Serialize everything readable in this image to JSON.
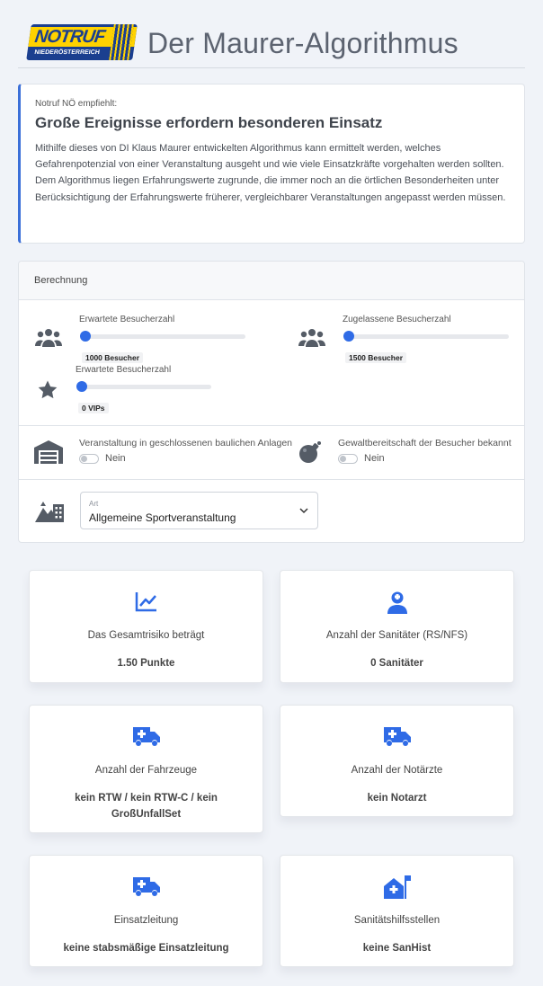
{
  "header": {
    "logo_text_top": "NOTRUF",
    "logo_text_bottom": "NIEDERÖSTERREICH",
    "title": "Der Maurer-Algorithmus"
  },
  "intro": {
    "pretitle": "Notruf NÖ empfiehlt:",
    "title": "Große Ereignisse erfordern besonderen Einsatz",
    "body": "Mithilfe dieses von DI Klaus Maurer entwickelten Algorithmus kann ermittelt werden, welches Gefahrenpotenzial von einer Veranstaltung ausgeht und wie viele Einsatzkräfte vorgehalten werden sollten. Dem Algorithmus liegen Erfahrungswerte zugrunde, die immer noch an die örtlichen Besonderheiten unter Berücksichtigung der Erfahrungswerte früherer, vergleichbarer Veranstaltungen angepasst werden müssen."
  },
  "calc": {
    "header": "Berechnung",
    "sliders": [
      {
        "label": "Erwartete Besucherzahl",
        "value": "1000 Besucher",
        "icon": "people-group-icon",
        "fill": 0.0
      },
      {
        "label": "Zugelassene Besucherzahl",
        "value": "1500 Besucher",
        "icon": "people-group-icon",
        "fill": 0.0
      },
      {
        "label": "Erwartete Besucherzahl",
        "value": "0 VIPs",
        "icon": "star-icon",
        "fill": 0.0
      }
    ],
    "toggles": [
      {
        "label": "Veranstaltung in geschlossenen baulichen Anlagen",
        "value": "Nein",
        "icon": "warehouse-icon"
      },
      {
        "label": "Gewaltbereitschaft der Besucher bekannt",
        "value": "Nein",
        "icon": "bomb-icon"
      }
    ],
    "select": {
      "label": "Art",
      "value": "Allgemeine Sportveranstaltung",
      "icon": "city-mountain-icon"
    }
  },
  "results": [
    {
      "label": "Das Gesamtrisiko beträgt",
      "value": "1.50 Punkte",
      "icon": "chart-line-icon"
    },
    {
      "label": "Anzahl der Sanitäter (RS/NFS)",
      "value": "0 Sanitäter",
      "icon": "medic-icon"
    },
    {
      "label": "Anzahl der Fahrzeuge",
      "value": "kein RTW / kein RTW-C / kein GroßUnfallSet",
      "icon": "ambulance-icon"
    },
    {
      "label": "Anzahl der Notärzte",
      "value": "kein Notarzt",
      "icon": "ambulance-icon"
    },
    {
      "label": "Einsatzleitung",
      "value": "keine stabsmäßige Einsatzleitung",
      "icon": "ambulance-icon"
    },
    {
      "label": "Sanitätshilfsstellen",
      "value": "keine SanHist",
      "icon": "house-medical-flag-icon"
    }
  ],
  "colors": {
    "accent": "#2f6be6",
    "text": "#444444",
    "background": "#f0f3f8"
  }
}
